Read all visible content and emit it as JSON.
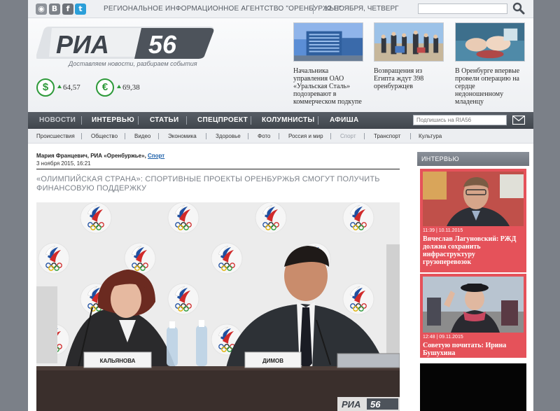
{
  "topbar": {
    "social": [
      "rss-icon",
      "livejournal-icon",
      "facebook-icon",
      "twitter-icon"
    ],
    "agency": "РЕГИОНАЛЬНОЕ ИНФОРМАЦИОННОЕ АГЕНТСТВО \"ОРЕНБУРЖЬЕ\"",
    "date": "12 НОЯБРЯ, ЧЕТВЕРГ",
    "search_value": ""
  },
  "header": {
    "logo_text": "РИА",
    "logo_num": "56",
    "tagline": "Доставляем новости, разбираем события",
    "rates": [
      {
        "symbol": "$",
        "value": "64,57",
        "trend": "up"
      },
      {
        "symbol": "€",
        "value": "69,38",
        "trend": "up"
      }
    ],
    "news": [
      {
        "caption": "Начальника управления ОАО «Уральская Сталь» подозревают в коммерческом подкупе"
      },
      {
        "caption": "Возвращения из Египта ждут 398 оренбуржцев"
      },
      {
        "caption": "В Оренбурге впервые провели операцию на сердце недоношенному младенцу"
      }
    ]
  },
  "mainnav": {
    "items": [
      "НОВОСТИ",
      "ИНТЕРВЬЮ",
      "СТАТЬИ",
      "СПЕЦПРОЕКТ",
      "КОЛУМНИСТЫ",
      "АФИША"
    ],
    "subscribe_placeholder": "Подпишись на RIA56"
  },
  "subnav": {
    "items": [
      "Происшествия",
      "Общество",
      "Видео",
      "Экономика",
      "Здоровье",
      "Фото",
      "Россия и мир",
      "Спорт",
      "Транспорт",
      "Культура"
    ]
  },
  "article": {
    "author": "Мария Францевич, РИА «Оренбуржье»",
    "section": "Спорт",
    "date": "3 ноября 2015, 16:21",
    "headline": "«ОЛИМПИЙСКАЯ СТРАНА»: СПОРТИВНЫЕ ПРОЕКТЫ ОРЕНБУРЖЬЯ СМОГУТ ПОЛУЧИТЬ ФИНАНСОВУЮ ПОДДЕРЖКУ",
    "photo": {
      "nameplate_left": "КАЛЬЯНОВА",
      "nameplate_right": "ДИМОВ",
      "watermark_text": "РИА",
      "watermark_num": "56"
    }
  },
  "sidebar": {
    "heading": "ИНТЕРВЬЮ",
    "cards": [
      {
        "time": "11:39 | 10.11.2015",
        "title": "Вячеслав Лагуновский: РЖД должна сохранить инфраструктуру грузоперевозок"
      },
      {
        "time": "12:48 | 09.11.2015",
        "title": "Советую почитать: Ирина Бушухина"
      }
    ]
  },
  "colors": {
    "accent_red": "#e5525a",
    "nav_dark": "#4a5058",
    "rate_green": "#2e9a3a",
    "link_blue": "#1a5ea8"
  }
}
